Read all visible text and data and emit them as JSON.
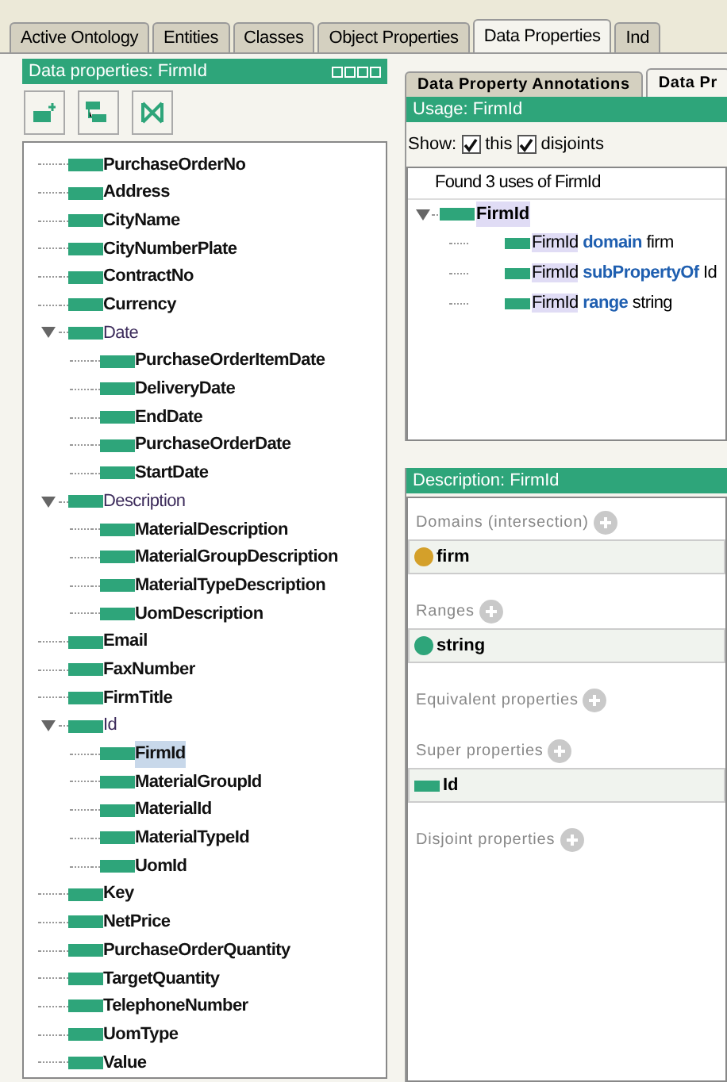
{
  "main_tabs": [
    {
      "label": "Active Ontology",
      "selected": false
    },
    {
      "label": "Entities",
      "selected": false
    },
    {
      "label": "Classes",
      "selected": false
    },
    {
      "label": "Object Properties",
      "selected": false
    },
    {
      "label": "Data Properties",
      "selected": true
    },
    {
      "label": "Ind",
      "selected": false
    }
  ],
  "hierarchy_panel": {
    "title": "Data properties: FirmId",
    "tree": [
      {
        "label": "PurchaseOrderNo",
        "selected": false
      },
      {
        "label": "Address",
        "selected": false
      },
      {
        "label": "CityName",
        "selected": false
      },
      {
        "label": "CityNumberPlate",
        "selected": false
      },
      {
        "label": "ContractNo",
        "selected": false
      },
      {
        "label": "Currency",
        "selected": false
      },
      {
        "label": "Date",
        "selected": false,
        "expanded": true,
        "children": [
          {
            "label": "PurchaseOrderItemDate",
            "selected": false
          },
          {
            "label": "DeliveryDate",
            "selected": false
          },
          {
            "label": "EndDate",
            "selected": false
          },
          {
            "label": "PurchaseOrderDate",
            "selected": false
          },
          {
            "label": "StartDate",
            "selected": false
          }
        ]
      },
      {
        "label": "Description",
        "selected": false,
        "expanded": true,
        "children": [
          {
            "label": "MaterialDescription",
            "selected": false
          },
          {
            "label": "MaterialGroupDescription",
            "selected": false
          },
          {
            "label": "MaterialTypeDescription",
            "selected": false
          },
          {
            "label": "UomDescription",
            "selected": false
          }
        ]
      },
      {
        "label": "Email",
        "selected": false
      },
      {
        "label": "FaxNumber",
        "selected": false
      },
      {
        "label": "FirmTitle",
        "selected": false
      },
      {
        "label": "Id",
        "selected": false,
        "expanded": true,
        "children": [
          {
            "label": "FirmId",
            "selected": true
          },
          {
            "label": "MaterialGroupId",
            "selected": false
          },
          {
            "label": "MaterialId",
            "selected": false
          },
          {
            "label": "MaterialTypeId",
            "selected": false
          },
          {
            "label": "UomId",
            "selected": false
          }
        ]
      },
      {
        "label": "Key",
        "selected": false
      },
      {
        "label": "NetPrice",
        "selected": false
      },
      {
        "label": "PurchaseOrderQuantity",
        "selected": false
      },
      {
        "label": "TargetQuantity",
        "selected": false
      },
      {
        "label": "TelephoneNumber",
        "selected": false
      },
      {
        "label": "UomType",
        "selected": false
      },
      {
        "label": "Value",
        "selected": false
      }
    ]
  },
  "sub_tabs": [
    {
      "label": "Data Property Annotations",
      "selected": false
    },
    {
      "label": "Data Pr",
      "selected": true
    }
  ],
  "usage_panel": {
    "title": "Usage: FirmId",
    "show_label": "Show:",
    "options": [
      {
        "label": "this",
        "checked": true
      },
      {
        "label": "disjoints",
        "checked": true
      }
    ],
    "summary": "Found 3 uses of FirmId",
    "root": {
      "label": "FirmId",
      "expanded": true
    },
    "axioms": [
      {
        "subject": "FirmId",
        "predicate": "domain",
        "object": "firm"
      },
      {
        "subject": "FirmId",
        "predicate": "subPropertyOf",
        "object": "Id"
      },
      {
        "subject": "FirmId",
        "predicate": "range",
        "object": "string"
      }
    ]
  },
  "description_panel": {
    "title": "Description: FirmId",
    "sections": [
      {
        "title": "Domains (intersection)",
        "items": [
          {
            "label": "firm",
            "kind": "class"
          }
        ]
      },
      {
        "title": "Ranges",
        "items": [
          {
            "label": "string",
            "kind": "datatype"
          }
        ]
      },
      {
        "title": "Equivalent properties"
      },
      {
        "title": "Super properties",
        "items": [
          {
            "label": "Id",
            "kind": "property"
          }
        ]
      },
      {
        "title": "Disjoint properties"
      }
    ]
  }
}
